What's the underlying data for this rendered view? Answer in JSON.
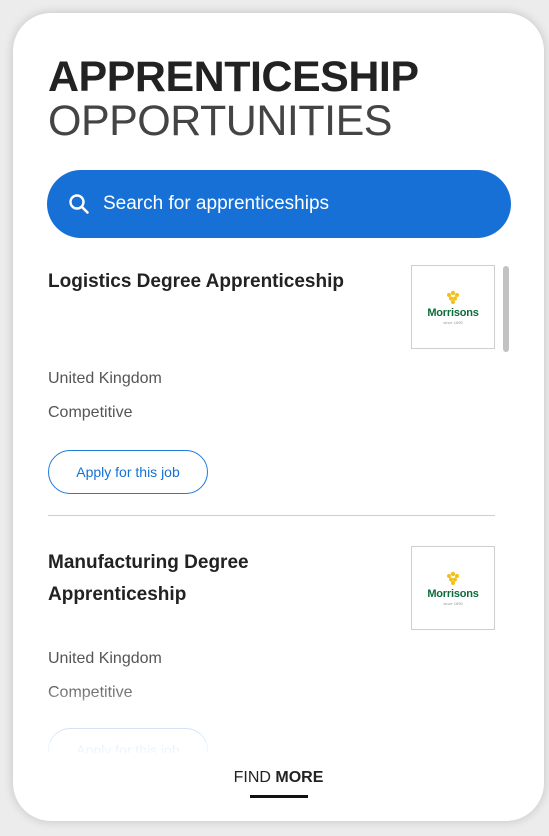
{
  "header": {
    "title_line1": "APPRENTICESHIP",
    "title_line2": "OPPORTUNITIES"
  },
  "search": {
    "placeholder": "Search for apprenticeships",
    "icon": "search-icon"
  },
  "jobs": [
    {
      "title": "Logistics Degree Apprenticeship",
      "location": "United Kingdom",
      "salary": "Competitive",
      "apply_label": "Apply for this job",
      "logo_text": "Morrisons",
      "logo_sub": "since 1899"
    },
    {
      "title": "Manufacturing Degree Apprenticeship",
      "location": "United Kingdom",
      "salary": "Competitive",
      "apply_label": "Apply for this job",
      "logo_text": "Morrisons",
      "logo_sub": "since 1899"
    }
  ],
  "footer": {
    "find_label": "FIND",
    "more_label": "MORE"
  },
  "colors": {
    "accent": "#1670d6",
    "logo_green": "#0d6b3a",
    "logo_yellow": "#f3c01a"
  }
}
